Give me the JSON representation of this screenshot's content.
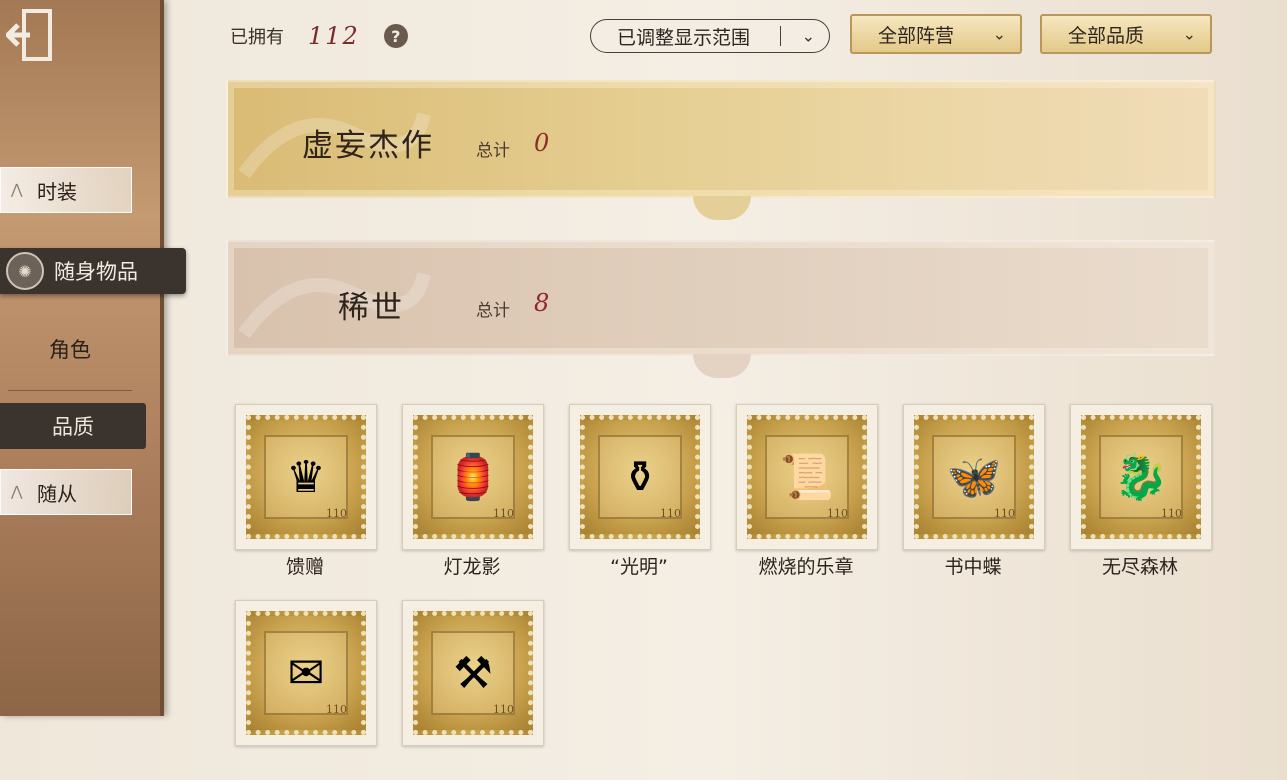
{
  "sidebar": {
    "exit_icon": "exit-door-icon",
    "tag_costume": "时装",
    "active_item": "随身物品",
    "role": "角色",
    "quality": "品质",
    "follower": "随从"
  },
  "header": {
    "owned_label": "已拥有",
    "owned_count": "112",
    "help_icon": "question-icon",
    "range_filter": "已调整显示范围",
    "camp_filter": "全部阵营",
    "quality_filter": "全部品质"
  },
  "banners": [
    {
      "title": "虚妄杰作",
      "total_label": "总计",
      "total": "0"
    },
    {
      "title": "稀世",
      "total_label": "总计",
      "total": "8"
    }
  ],
  "items": [
    {
      "name": "馈赠",
      "icon": "crown-flame-icon",
      "glyph": "♛"
    },
    {
      "name": "灯龙影",
      "icon": "lantern-icon",
      "glyph": "🏮"
    },
    {
      "name": "“光明”",
      "icon": "gourd-bottle-icon",
      "glyph": "⚱"
    },
    {
      "name": "燃烧的乐章",
      "icon": "burning-scroll-icon",
      "glyph": "📜"
    },
    {
      "name": "书中蝶",
      "icon": "book-butterfly-icon",
      "glyph": "🦋"
    },
    {
      "name": "无尽森林",
      "icon": "serpent-key-icon",
      "glyph": "🐉"
    },
    {
      "name": "",
      "icon": "winged-letter-icon",
      "glyph": "✉"
    },
    {
      "name": "",
      "icon": "scythe-icon",
      "glyph": "⚒"
    }
  ],
  "stamp_corner": "110",
  "colors": {
    "accent_red": "#8d2a2a",
    "gold": "#d9bb74",
    "dark_tab": "#3b342e"
  }
}
